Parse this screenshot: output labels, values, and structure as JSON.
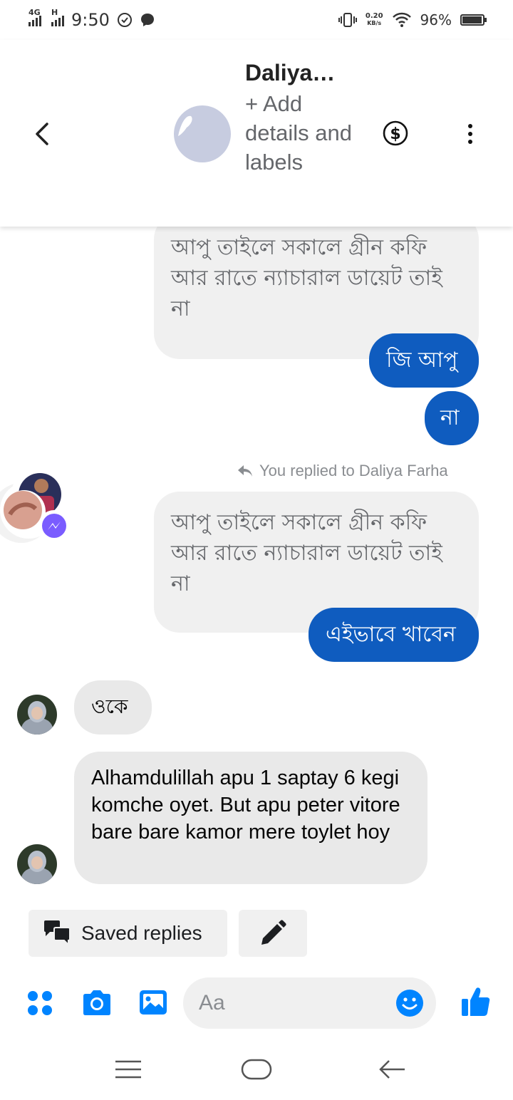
{
  "status_bar": {
    "network_1": "4G",
    "network_2": "H",
    "time": "9:50",
    "speed_value": "0.20",
    "speed_unit": "KB/s",
    "battery": "96%",
    "battery_level": 0.96
  },
  "header": {
    "contact_name": "Daliya…",
    "subtitle": "+ Add details and labels"
  },
  "messages": {
    "m1": "আপু তাইলে সকালে গ্রীন কফি আর রাতে ন্যাচারাল ডায়েট তাই না",
    "m2": "জি আপু",
    "m3": "না",
    "reply_note": "You replied to Daliya Farha",
    "m4": "আপু তাইলে সকালে গ্রীন কফি আর রাতে ন্যাচারাল ডায়েট তাই না",
    "m5": "এইভাবে খাবেন",
    "m6": "ওকে",
    "m7": "Alhamdulillah apu 1 saptay 6 kegi komche oyet. But apu peter vitore bare bare kamor mere toylet hoy"
  },
  "quick_actions": {
    "saved_replies": "Saved replies"
  },
  "composer": {
    "placeholder": "Aa"
  },
  "colors": {
    "accent": "#0084ff",
    "sent_bubble": "#0f5cbf",
    "received_bubble": "#e9e9e9"
  }
}
